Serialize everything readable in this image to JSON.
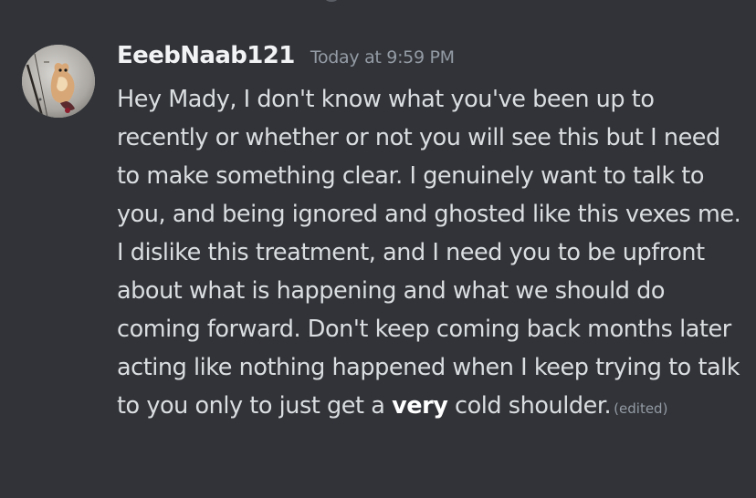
{
  "message": {
    "username": "EeebNaab121",
    "timestamp": "Today at 9:59 PM",
    "body": {
      "before_bold": "Hey Mady, I don't know what you've been up to recently or whether or not you will see this but I need to make something clear. I genuinely want to talk to you, and being ignored and ghosted like this vexes me. I dislike this treatment, and I need you to be upfront about what is happening and what we should do coming forward. Don't keep coming back months later acting like nothing happened when I keep trying to talk to you only to just get a ",
      "bold": "very",
      "after_bold": " cold shoulder."
    },
    "edited_label": "(edited)",
    "avatar_icon": "user-avatar-image"
  },
  "colors": {
    "background": "#313338",
    "username": "#f2f3f5",
    "text": "#dbdee1",
    "muted": "#949ba4"
  }
}
